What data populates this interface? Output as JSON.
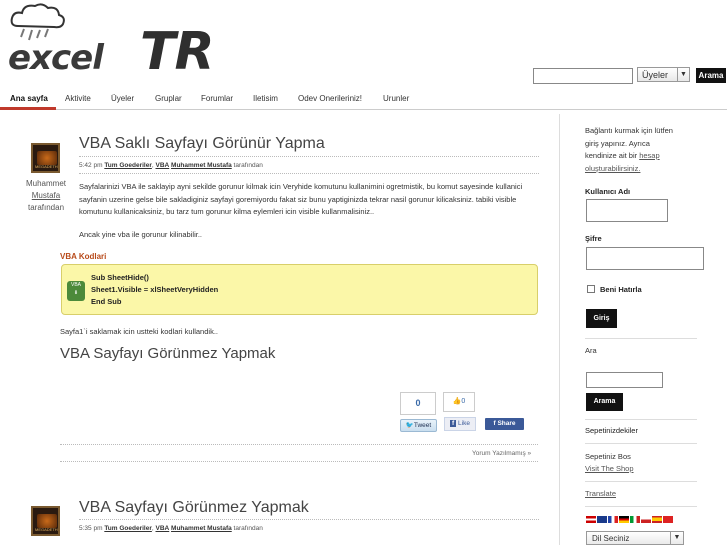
{
  "header": {
    "logo_excel": "excel",
    "logo_tr": "TR",
    "search_value": "",
    "search_scope": "Üyeler",
    "search_button": "Arama"
  },
  "nav": {
    "items": [
      {
        "label": "Ana sayfa",
        "active": true
      },
      {
        "label": "Aktivite"
      },
      {
        "label": "Üyeler"
      },
      {
        "label": "Gruplar"
      },
      {
        "label": "Forumlar"
      },
      {
        "label": "Iletisim"
      },
      {
        "label": "Odev Onerileriniz!"
      },
      {
        "label": "Urunler"
      }
    ]
  },
  "posts": [
    {
      "title": "VBA Saklı Sayfayı Görünür Yapma",
      "time": "5:42 pm",
      "category_1": "Tum Goederiler",
      "category_2": "VBA",
      "author": "Muhammet Mustafa",
      "by": "tarafından",
      "avatar_label": "MEGADETH",
      "side_author_1": "Muhammet",
      "side_author_2": "Mustafa",
      "side_author_3": "tarafından",
      "paragraph_1": "Sayfalarinizi VBA ile saklayip ayni sekilde gorunur kilmak icin Veryhide komutunu kullanimini ogretmistik, bu komut sayesinde kullanici sayfanin uzerine gelse bile sakladiginiz sayfayi goremiyordu fakat siz bunu yaptiginizda tekrar nasil gorunur kilicaksiniz. tabiki visible komutunu kullanicaksiniz, bu tarz tum gorunur kilma eylemleri icin visible kullanmalisiniz..",
      "paragraph_2": "Ancak yine vba ile gorunur kilinabilir..",
      "code_label": "VBA Kodlari",
      "code_icon": "VBA",
      "code_lines": [
        "Sub SheetHide()",
        "Sheet1.Visible = xlSheetVeryHidden",
        "End Sub"
      ],
      "paragraph_3": "Sayfa1`i saklamak icin ustteki kodlari kullandik..",
      "related_title": "VBA Sayfayı Görünmez Yapmak",
      "share_count": "0",
      "like_count": "0",
      "tweet": "Tweet",
      "fb_like": "Like",
      "fb_share": "Share",
      "comments": "Yorum Yazılmamış »"
    },
    {
      "title": "VBA Sayfayı Görünmez Yapmak",
      "time": "5:35 pm",
      "category_1": "Tum Goederiler",
      "category_2": "VBA",
      "author": "Muhammet Mustafa",
      "by": "tarafından",
      "avatar_label": "MEGADETH"
    }
  ],
  "sidebar": {
    "login_line_1": "Bağlantı kurmak için lütfen",
    "login_line_2": "giriş yapınız. Ayrıca",
    "login_line_3a": "kendinize ait bir ",
    "login_link_a": "hesap",
    "login_link_b": "oluşturabilirsiniz.",
    "username_label": "Kullanıcı Adı",
    "username_value": "",
    "password_label": "Şifre",
    "password_value": "",
    "remember_label": "Beni Hatırla",
    "login_button": "Giriş",
    "search_heading": "Ara",
    "search_value": "",
    "search_button": "Arama",
    "cart_heading": "Sepetinizdekiler",
    "cart_empty": "Sepetiniz Bos",
    "shop_link": "Visit The Shop",
    "translate_link": "Translate",
    "language_select": "Dil Seciniz"
  },
  "colors": {
    "accent": "#c0392b",
    "code_bg": "#fbf7a8",
    "facebook": "#3b5998"
  }
}
